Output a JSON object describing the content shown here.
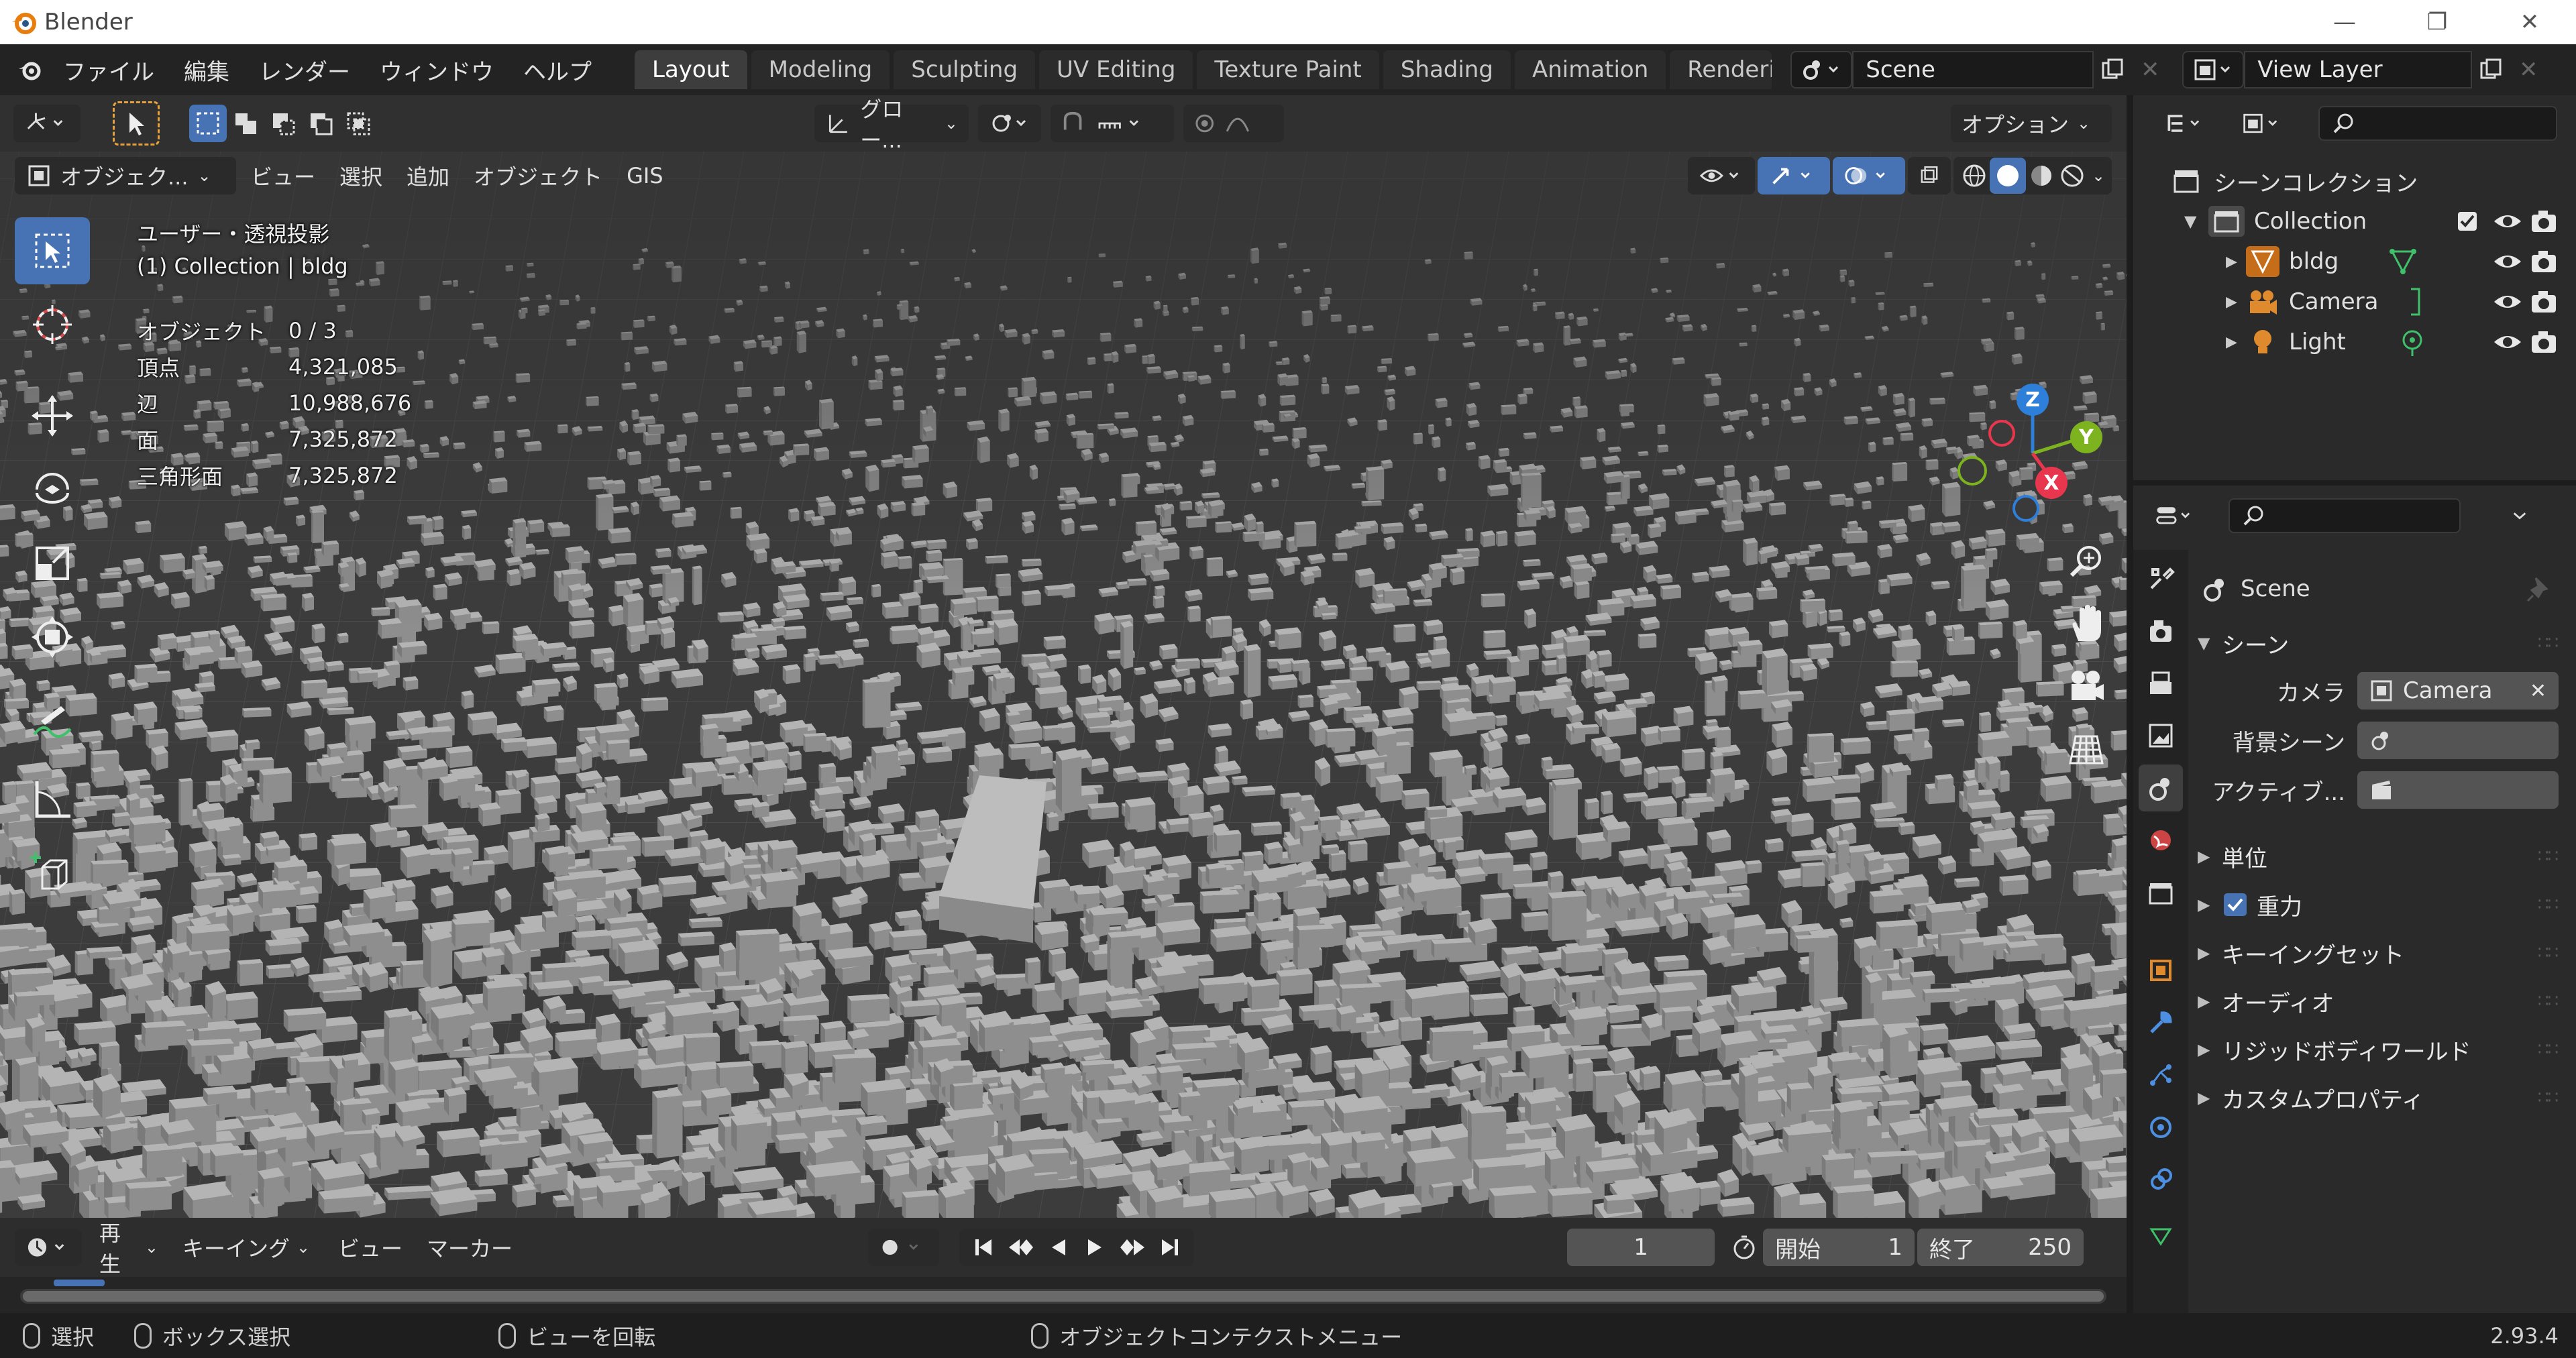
{
  "window": {
    "title": "Blender",
    "controls": {
      "minimize": "—",
      "restore": "❐",
      "close": "✕"
    }
  },
  "topbar": {
    "menus": [
      "ファイル",
      "編集",
      "レンダー",
      "ウィンドウ",
      "ヘルプ"
    ],
    "workspaces": [
      "Layout",
      "Modeling",
      "Sculpting",
      "UV Editing",
      "Texture Paint",
      "Shading",
      "Animation",
      "Rendering"
    ],
    "active_workspace": "Layout",
    "scene_field": "Scene",
    "view_layer_field": "View Layer"
  },
  "viewport_header": {
    "transform_orientation": "グロー...",
    "options_label": "オプション"
  },
  "viewport_header2": {
    "mode": "オブジェク...",
    "menus": [
      "ビュー",
      "選択",
      "追加",
      "オブジェクト",
      "GIS"
    ]
  },
  "viewport": {
    "view_name": "ユーザー・透視投影",
    "collection_info": "(1) Collection | bldg",
    "stats": [
      {
        "label": "オブジェクト",
        "value": "0 / 3"
      },
      {
        "label": "頂点",
        "value": "4,321,085"
      },
      {
        "label": "辺",
        "value": "10,988,676"
      },
      {
        "label": "面",
        "value": "7,325,872"
      },
      {
        "label": "三角形面",
        "value": "7,325,872"
      }
    ],
    "gizmo_axes": {
      "x": "X",
      "y": "Y",
      "z": "Z"
    }
  },
  "timeline": {
    "playback": "再生",
    "keying": "キーイング",
    "view": "ビュー",
    "marker": "マーカー",
    "current_frame": "1",
    "start_label": "開始",
    "start_value": "1",
    "end_label": "終了",
    "end_value": "250"
  },
  "statusbar": {
    "items": [
      "選択",
      "ボックス選択",
      "ビューを回転",
      "オブジェクトコンテクストメニュー"
    ],
    "version": "2.93.4"
  },
  "outliner": {
    "scene_collection": "シーンコレクション",
    "items": [
      {
        "name": "Collection",
        "depth": 1
      },
      {
        "name": "bldg",
        "depth": 2
      },
      {
        "name": "Camera",
        "depth": 2
      },
      {
        "name": "Light",
        "depth": 2
      }
    ]
  },
  "properties": {
    "context": "Scene",
    "section_scene": "シーン",
    "camera_label": "カメラ",
    "camera_value": "Camera",
    "bg_scene_label": "背景シーン",
    "active_label": "アクティブ...",
    "panels": [
      "単位",
      "重力",
      "キーイングセット",
      "オーディオ",
      "リジッドボディワールド",
      "カスタムプロパティ"
    ],
    "gravity_checked": true
  },
  "colors": {
    "accent": "#4772b3",
    "axis_x": "#e8364e",
    "axis_y": "#7cb31e",
    "axis_z": "#2e7fd9",
    "building": "#a9a9a9",
    "ground": "#3d3d3d"
  }
}
